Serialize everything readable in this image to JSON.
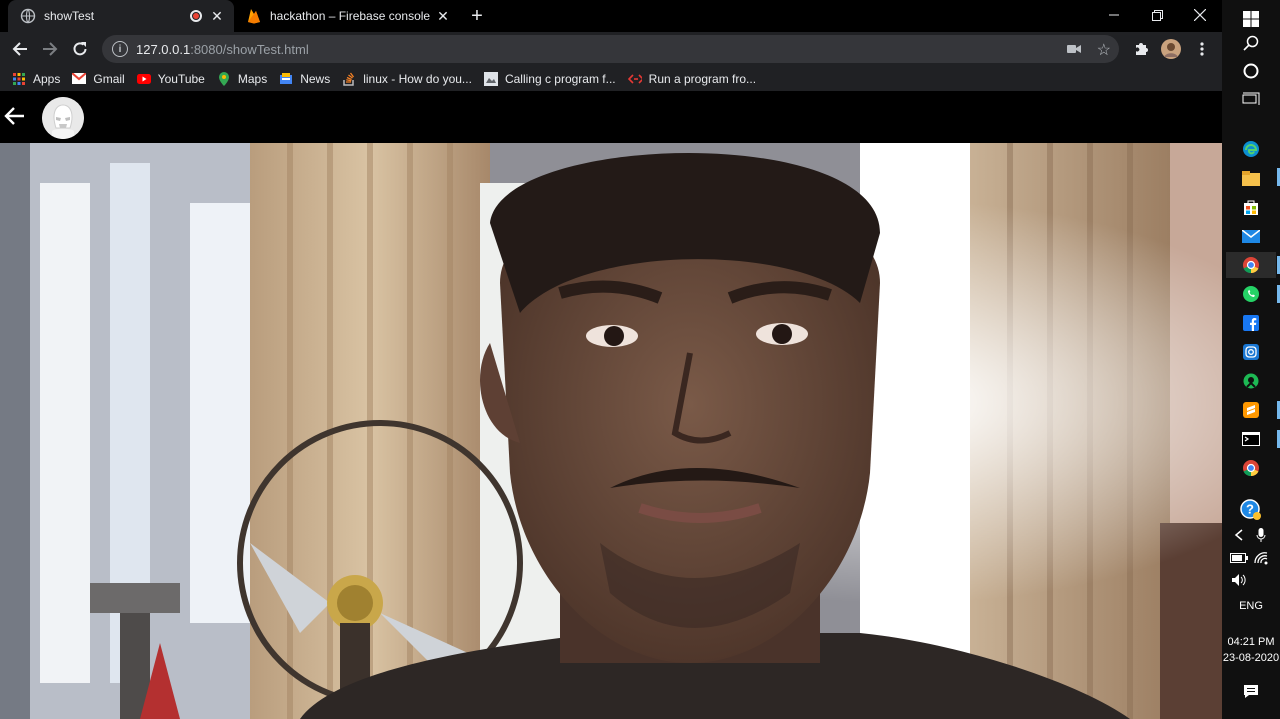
{
  "tabs": [
    {
      "title": "showTest",
      "icon": "globe-icon",
      "recording": true
    },
    {
      "title": "hackathon – Firebase console",
      "icon": "firebase-icon",
      "recording": false
    }
  ],
  "address_bar": {
    "host": "127.0.0.1",
    "rest": ":8080/showTest.html"
  },
  "bookmarks": [
    {
      "label": "Apps",
      "icon": "apps-grid-icon"
    },
    {
      "label": "Gmail",
      "icon": "gmail-icon"
    },
    {
      "label": "YouTube",
      "icon": "youtube-icon"
    },
    {
      "label": "Maps",
      "icon": "maps-icon"
    },
    {
      "label": "News",
      "icon": "news-icon"
    },
    {
      "label": "linux - How do you...",
      "icon": "stackoverflow-icon"
    },
    {
      "label": "Calling c program f...",
      "icon": "page-icon"
    },
    {
      "label": "Run a program fro...",
      "icon": "code-icon"
    }
  ],
  "page": {
    "header": {
      "back_icon": "back-arrow-icon",
      "avatar_icon": "stormtrooper-avatar-icon"
    }
  },
  "taskbar": {
    "apps": [
      "edge-icon",
      "file-explorer-icon",
      "store-icon",
      "mail-icon",
      "chrome-icon",
      "whatsapp-icon",
      "facebook-icon",
      "instagram-icon",
      "app-icon",
      "sublime-icon",
      "terminal-icon",
      "chrome-icon"
    ],
    "tray": {
      "language": "ENG",
      "time": "04:21 PM",
      "date": "23-08-2020"
    }
  },
  "colors": {
    "accent": "#76b9ed",
    "tab_active": "#202124",
    "recording": "#ea4335"
  }
}
